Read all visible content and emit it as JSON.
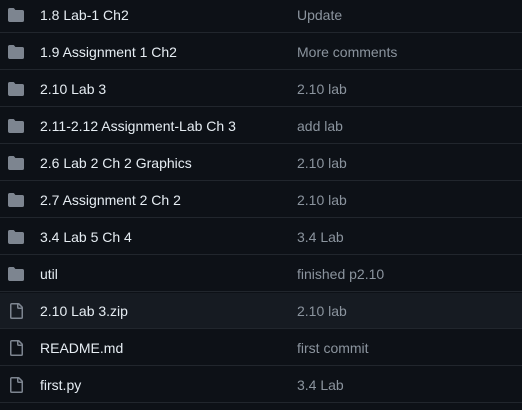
{
  "entries": [
    {
      "name": "1.8 Lab-1 Ch2",
      "message": "Update",
      "type": "folder",
      "icon": "folder-icon"
    },
    {
      "name": "1.9 Assignment 1 Ch2",
      "message": "More comments",
      "type": "folder",
      "icon": "folder-icon"
    },
    {
      "name": "2.10 Lab 3",
      "message": "2.10 lab",
      "type": "folder",
      "icon": "folder-icon"
    },
    {
      "name": "2.11-2.12 Assignment-Lab Ch 3",
      "message": "add lab",
      "type": "folder",
      "icon": "folder-icon"
    },
    {
      "name": "2.6 Lab 2 Ch 2 Graphics",
      "message": "2.10 lab",
      "type": "folder",
      "icon": "folder-icon"
    },
    {
      "name": "2.7 Assignment 2 Ch 2",
      "message": "2.10 lab",
      "type": "folder",
      "icon": "folder-icon"
    },
    {
      "name": "3.4 Lab 5 Ch 4",
      "message": "3.4 Lab",
      "type": "folder",
      "icon": "folder-icon"
    },
    {
      "name": "util",
      "message": "finished p2.10",
      "type": "folder",
      "icon": "folder-icon"
    },
    {
      "name": "2.10 Lab 3.zip",
      "message": "2.10 lab",
      "type": "file",
      "icon": "file-icon",
      "highlighted": true
    },
    {
      "name": "README.md",
      "message": "first commit",
      "type": "file",
      "icon": "file-icon"
    },
    {
      "name": "first.py",
      "message": "3.4 Lab",
      "type": "file",
      "icon": "file-icon"
    }
  ],
  "colors": {
    "background": "#0d1117",
    "row_hover": "#161b22",
    "divider": "#21262d",
    "name_text": "#e6edf3",
    "message_text": "#8b949e",
    "icon": "#7d8590"
  }
}
